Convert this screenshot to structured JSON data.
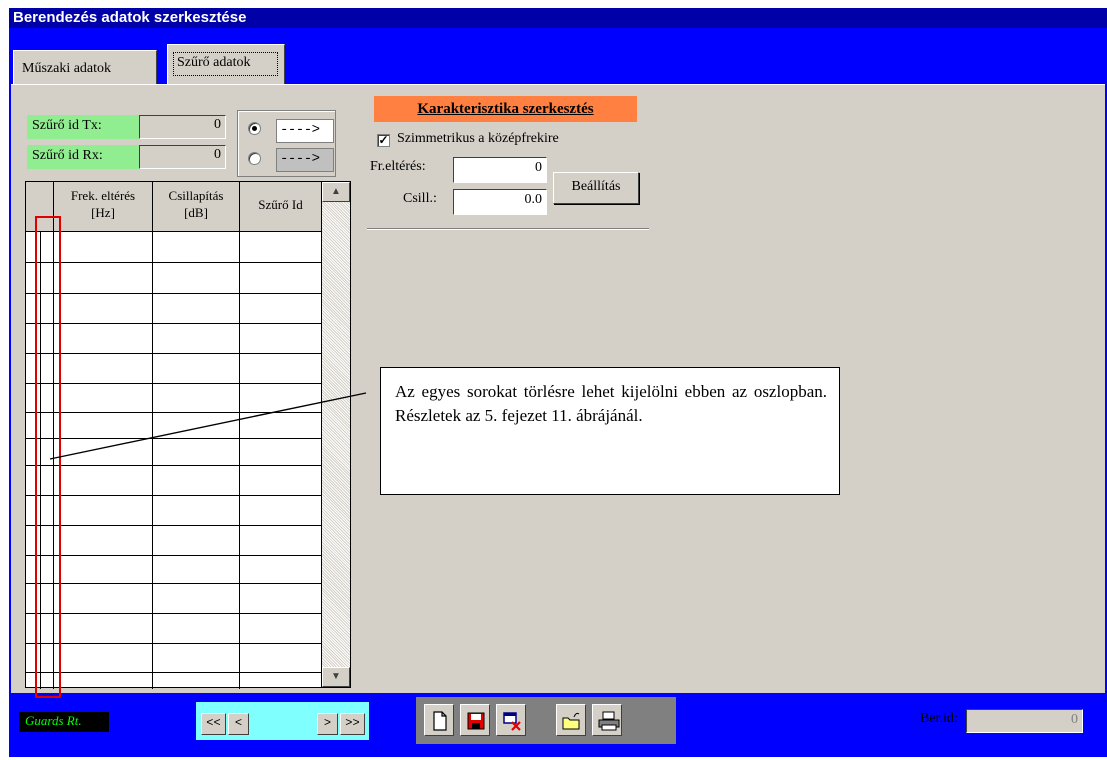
{
  "window": {
    "title": "Berendezés adatok szerkesztése"
  },
  "tabs": [
    {
      "label": "Műszaki adatok"
    },
    {
      "label": "Szűrő adatok"
    }
  ],
  "filter_ids": {
    "tx_label": "Szűrő id Tx:",
    "tx_value": "0",
    "rx_label": "Szűrő id Rx:",
    "rx_value": "0",
    "arrow1": "---->",
    "arrow2": "---->"
  },
  "grid": {
    "columns": [
      {
        "l1": "Frek. eltérés",
        "l2": "[Hz]"
      },
      {
        "l1": "Csillapítás",
        "l2": "[dB]"
      },
      {
        "l1": "Szűrő Id",
        "l2": ""
      }
    ],
    "scroll_up": "▲",
    "scroll_down": "▼"
  },
  "characteristic": {
    "title": "Karakterisztika szerkesztés",
    "symmetric_label": "Szimmetrikus a középfrekire",
    "symmetric_checked": "✓",
    "freq_label": "Fr.eltérés:",
    "freq_value": "0",
    "att_label": "Csill.:",
    "att_value": "0.0",
    "set_button": "Beállítás"
  },
  "callout": {
    "text": "Az egyes sorokat törlésre lehet kijelölni ebben az oszlopban. Részletek az 5. fejezet 11. ábrájánál."
  },
  "footer": {
    "brand": "Guards Rt.",
    "nav": [
      "<<",
      "<",
      ">",
      ">>"
    ],
    "tools": [
      "new-icon",
      "save-icon",
      "delete-icon",
      "open-folder-icon",
      "print-icon"
    ],
    "ber_id_label": "Ber.id:",
    "ber_id_value": "0"
  },
  "colors": {
    "title_bar": "#0000a8",
    "frame": "#0000ff",
    "panel": "#d4d0c8",
    "label_green": "#90ee90",
    "char_header": "#ff8040",
    "nav_bg": "#80ffff",
    "highlight_red": "#e00000"
  }
}
